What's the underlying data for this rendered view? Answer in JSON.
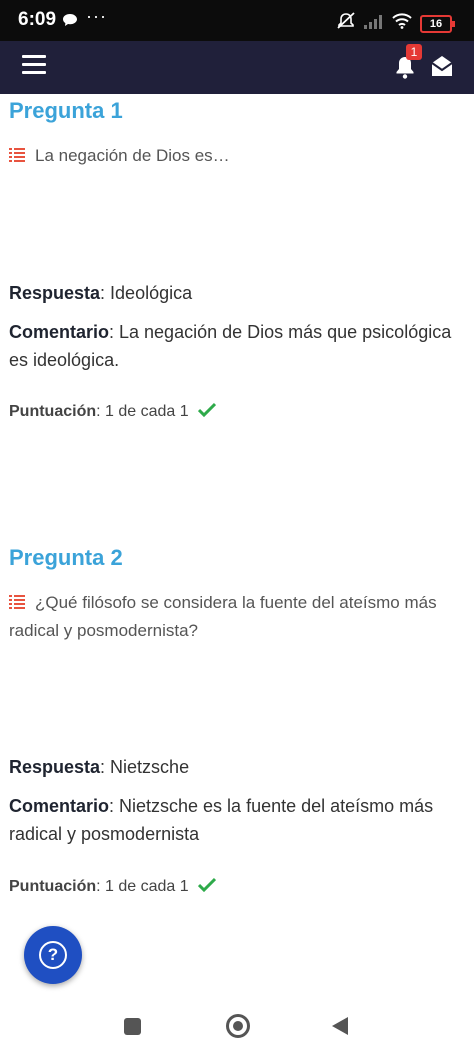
{
  "status": {
    "time": "6:09",
    "dots": "···",
    "battery": "16"
  },
  "appbar": {
    "notification_count": "1"
  },
  "questions": [
    {
      "title": "Pregunta 1",
      "text": "La negación de Dios es…",
      "answer_label": "Respuesta",
      "answer": ": Ideológica",
      "comment_label": "Comentario",
      "comment": ": La negación de Dios más que psicológica es ideológica.",
      "score_label": "Puntuación",
      "score": ": 1 de cada 1"
    },
    {
      "title": "Pregunta 2",
      "text": "¿Qué filósofo se considera la fuente del ateísmo más radical y posmodernista?",
      "answer_label": "Respuesta",
      "answer": ": Nietzsche",
      "comment_label": "Comentario",
      "comment": ": Nietzsche es la fuente del ateísmo más radical y posmodernista",
      "score_label": "Puntuación",
      "score": ": 1 de cada 1"
    }
  ],
  "help": {
    "symbol": "?"
  },
  "colors": {
    "accent": "#3ba3d9",
    "appbar": "#20203a",
    "check": "#2eaa4a",
    "fab": "#1f4fc2",
    "list_icon": "#e8533f"
  },
  "icons": [
    "chat-bubble-icon",
    "mute-icon",
    "signal-icon",
    "wifi-icon",
    "battery-icon",
    "menu-icon",
    "bell-icon",
    "envelope-icon",
    "list-icon",
    "checkmark-icon",
    "help-icon"
  ]
}
